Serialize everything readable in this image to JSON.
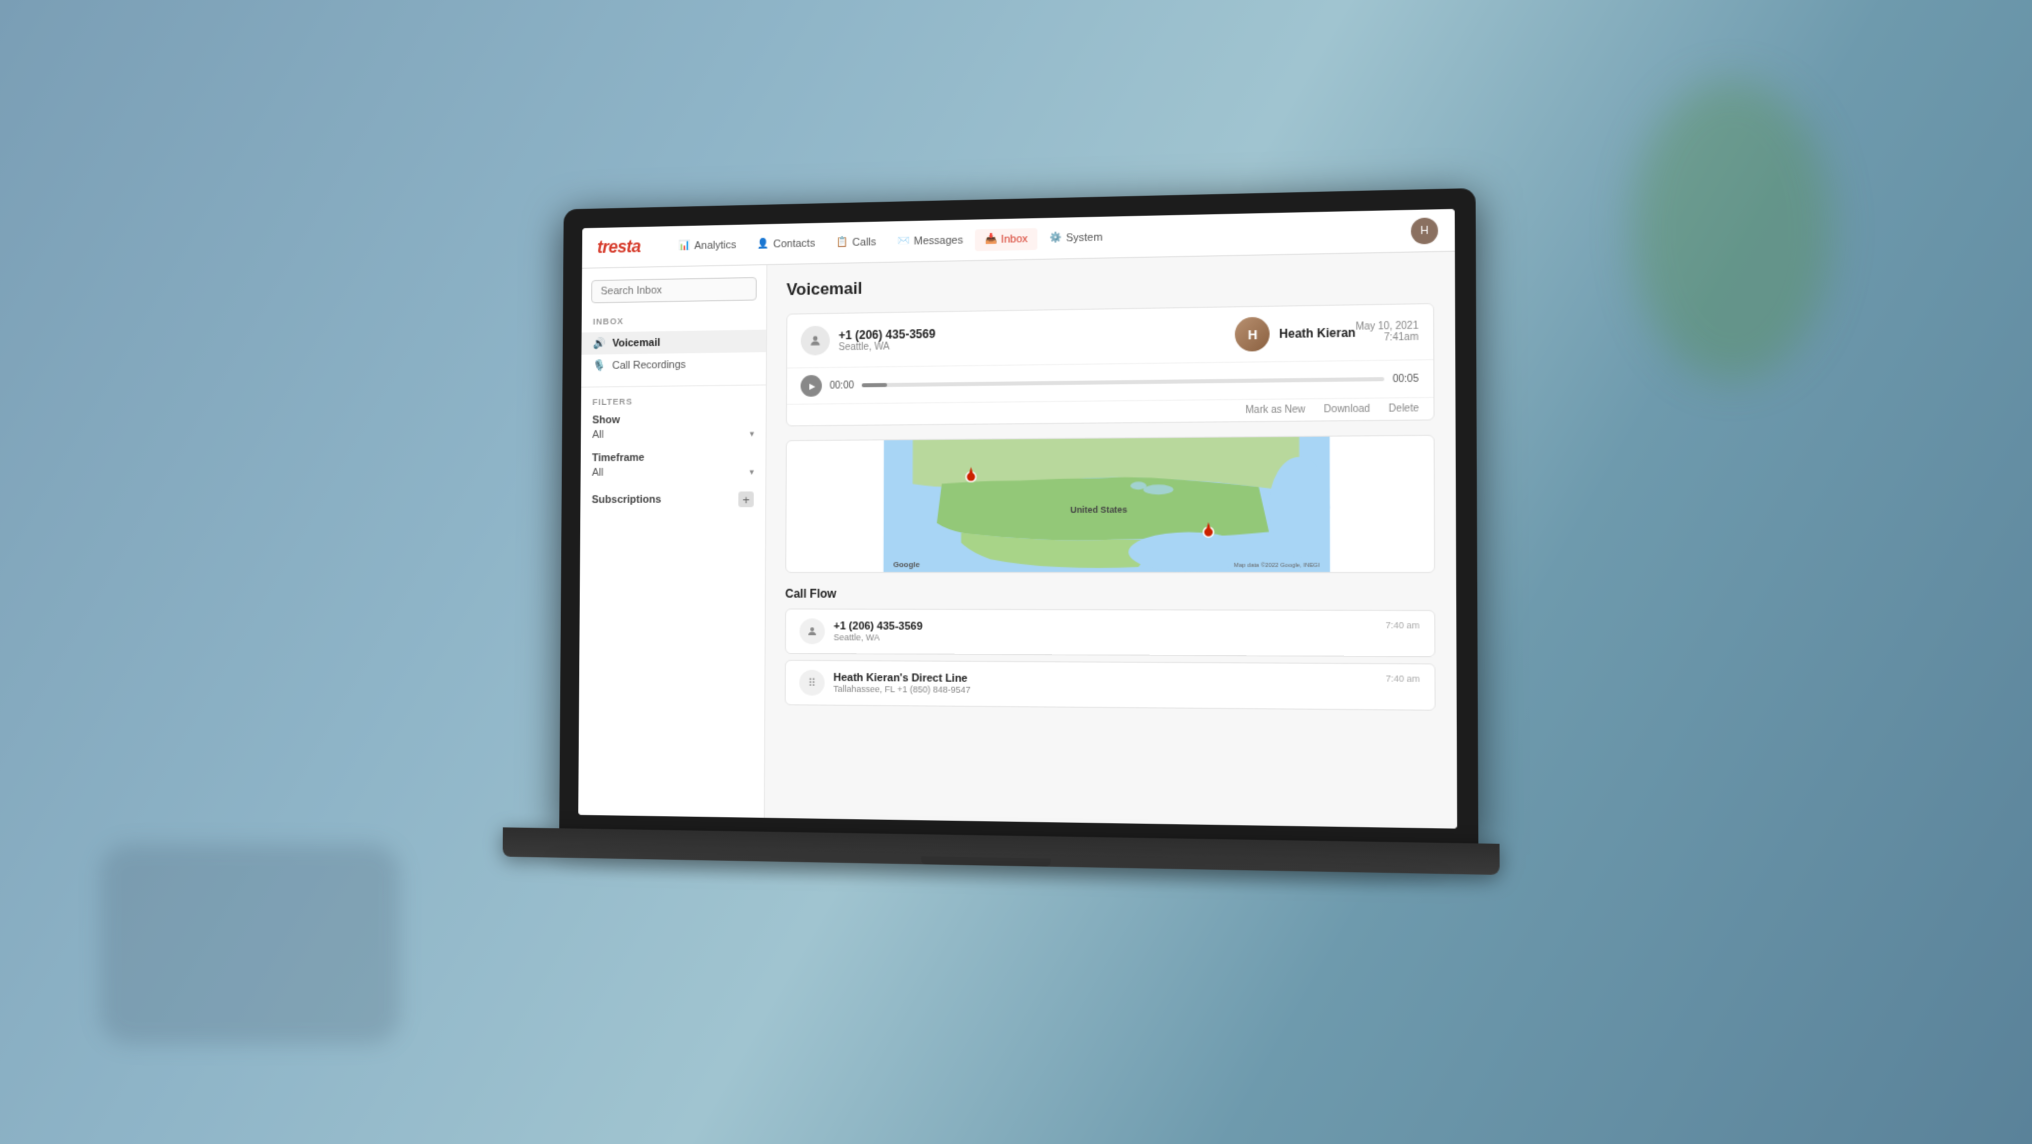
{
  "app": {
    "logo": "tresta",
    "nav": {
      "items": [
        {
          "id": "analytics",
          "label": "Analytics",
          "icon": "📊",
          "active": false
        },
        {
          "id": "contacts",
          "label": "Contacts",
          "icon": "👤",
          "active": false
        },
        {
          "id": "calls",
          "label": "Calls",
          "icon": "📋",
          "active": false
        },
        {
          "id": "messages",
          "label": "Messages",
          "icon": "✉️",
          "active": false
        },
        {
          "id": "inbox",
          "label": "Inbox",
          "icon": "📥",
          "active": true
        },
        {
          "id": "system",
          "label": "System",
          "icon": "⚙️",
          "active": false
        }
      ]
    }
  },
  "sidebar": {
    "search_placeholder": "Search Inbox",
    "inbox_section": "INBOX",
    "items": [
      {
        "id": "voicemail",
        "label": "Voicemail",
        "icon": "🔊",
        "active": true
      },
      {
        "id": "call-recordings",
        "label": "Call Recordings",
        "icon": "🎙️",
        "active": false
      }
    ],
    "filters_section": "FILTERS",
    "show_label": "Show",
    "show_value": "All",
    "timeframe_label": "Timeframe",
    "timeframe_value": "All",
    "subscriptions_label": "Subscriptions"
  },
  "voicemail": {
    "page_title": "Voicemail",
    "card": {
      "caller_phone": "+1 (206) 435-3569",
      "caller_location": "Seattle, WA",
      "contact_name": "Heath Kieran",
      "date": "May 10, 2021",
      "time": "7:41am",
      "player": {
        "current_time": "00:00",
        "duration": "00:05"
      },
      "actions": {
        "mark_new": "Mark as New",
        "download": "Download",
        "delete": "Delete"
      }
    }
  },
  "call_flow": {
    "title": "Call Flow",
    "items": [
      {
        "id": "item1",
        "phone": "+1 (206) 435-3569",
        "location": "Seattle, WA",
        "time": "7:40 am",
        "icon_type": "person"
      },
      {
        "id": "item2",
        "phone": "Heath Kieran's Direct Line",
        "location": "Tallahassee, FL  +1 (850) 848-9547",
        "time": "7:40 am",
        "icon_type": "grid"
      }
    ]
  },
  "map": {
    "pin1_label": "Seattle, WA",
    "pin2_label": "Tallahassee, FL",
    "label": "United States",
    "google_logo": "Google",
    "copyright": "Map data ©2022 Google, INEGI"
  }
}
